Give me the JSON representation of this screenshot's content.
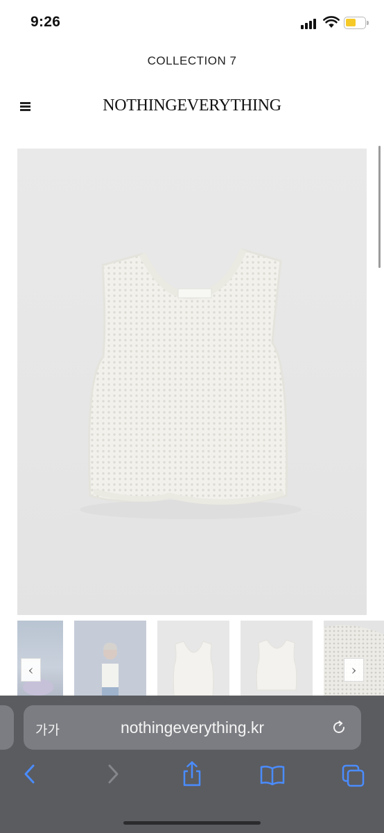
{
  "status_bar": {
    "time": "9:26",
    "icons": [
      "cellular-signal-icon",
      "wifi-icon",
      "battery-icon"
    ],
    "battery_color": "#f5c928"
  },
  "site": {
    "collection_label": "COLLECTION 7",
    "logo_text": "NOTHINGEVERYTHING",
    "menu_icon": "hamburger-menu-icon"
  },
  "gallery": {
    "main_image": "knit-tank-top-product-photo",
    "thumbnails": [
      "model-outdoor-photo",
      "model-wearing-tank-photo",
      "tank-front-photo",
      "tank-back-photo",
      "knit-detail-photo"
    ],
    "prev_arrow": "‹",
    "next_arrow": "›"
  },
  "safari": {
    "aa_label": "가가",
    "url": "nothingeverything.kr",
    "toolbar_icons": [
      "back-icon",
      "forward-icon",
      "share-icon",
      "bookmarks-icon",
      "tabs-icon"
    ],
    "accent_color": "#4a8cff"
  }
}
